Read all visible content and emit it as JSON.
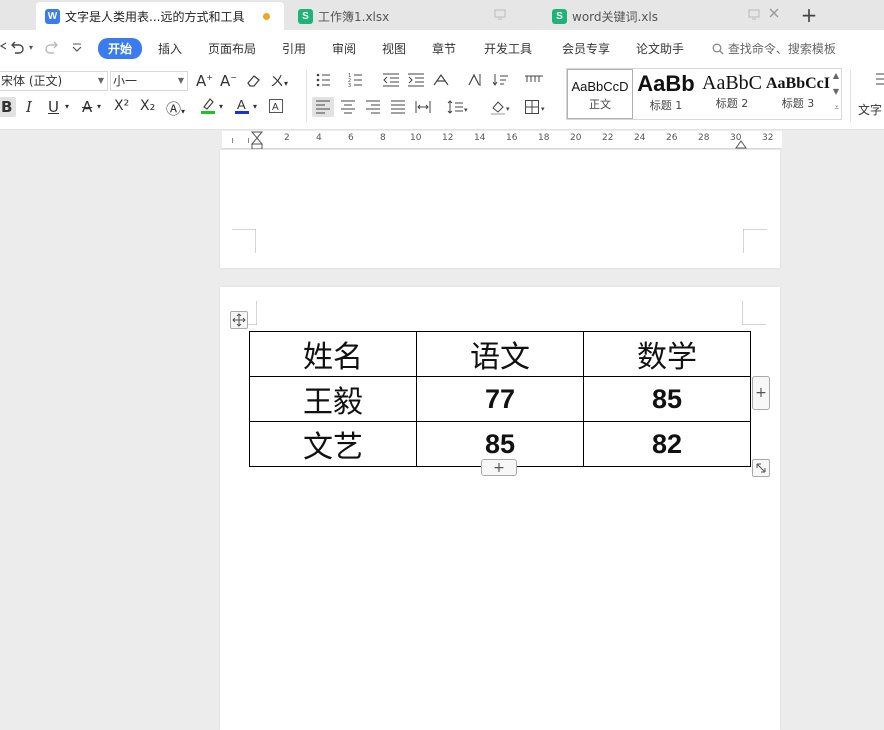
{
  "tabs": [
    {
      "label": "文字是人类用表...远的方式和工具",
      "icon": "W",
      "type": "wps-doc"
    },
    {
      "label": "工作簿1.xlsx",
      "icon": "S",
      "type": "wps-sheet"
    },
    {
      "label": "word关键词.xls",
      "icon": "S",
      "type": "wps-sheet"
    }
  ],
  "new_tab_label": "+",
  "menu": {
    "items": [
      "开始",
      "插入",
      "页面布局",
      "引用",
      "审阅",
      "视图",
      "章节",
      "开发工具",
      "会员专享",
      "论文助手"
    ],
    "active": "开始",
    "search_placeholder": "查找命令、搜索模板"
  },
  "ribbon": {
    "font_name": "宋体 (正文)",
    "font_size": "小一",
    "bold_label": "B",
    "italic_label": "I",
    "underline_label": "U",
    "superscript_label": "X²",
    "subscript_label": "X₂",
    "styles": [
      {
        "sample": "AaBbCcD",
        "label": "正文"
      },
      {
        "sample": "AaBb",
        "label": "标题 1"
      },
      {
        "sample": "AaBbC",
        "label": "标题 2"
      },
      {
        "sample": "AaBbCcI",
        "label": "标题 3"
      }
    ],
    "text_tools_label": "文字"
  },
  "ruler": {
    "labels": [
      "2",
      "4",
      "6",
      "8",
      "10",
      "12",
      "14",
      "16",
      "18",
      "20",
      "22",
      "24",
      "26",
      "28",
      "30",
      "32"
    ]
  },
  "table": {
    "headers": [
      "姓名",
      "语文",
      "数学"
    ],
    "rows": [
      [
        "王毅",
        "77",
        "85"
      ],
      [
        "文艺",
        "85",
        "82"
      ]
    ]
  },
  "colors": {
    "accent": "#3a7bf0",
    "highlight": "#22c022",
    "font_color": "#1a33d8"
  }
}
